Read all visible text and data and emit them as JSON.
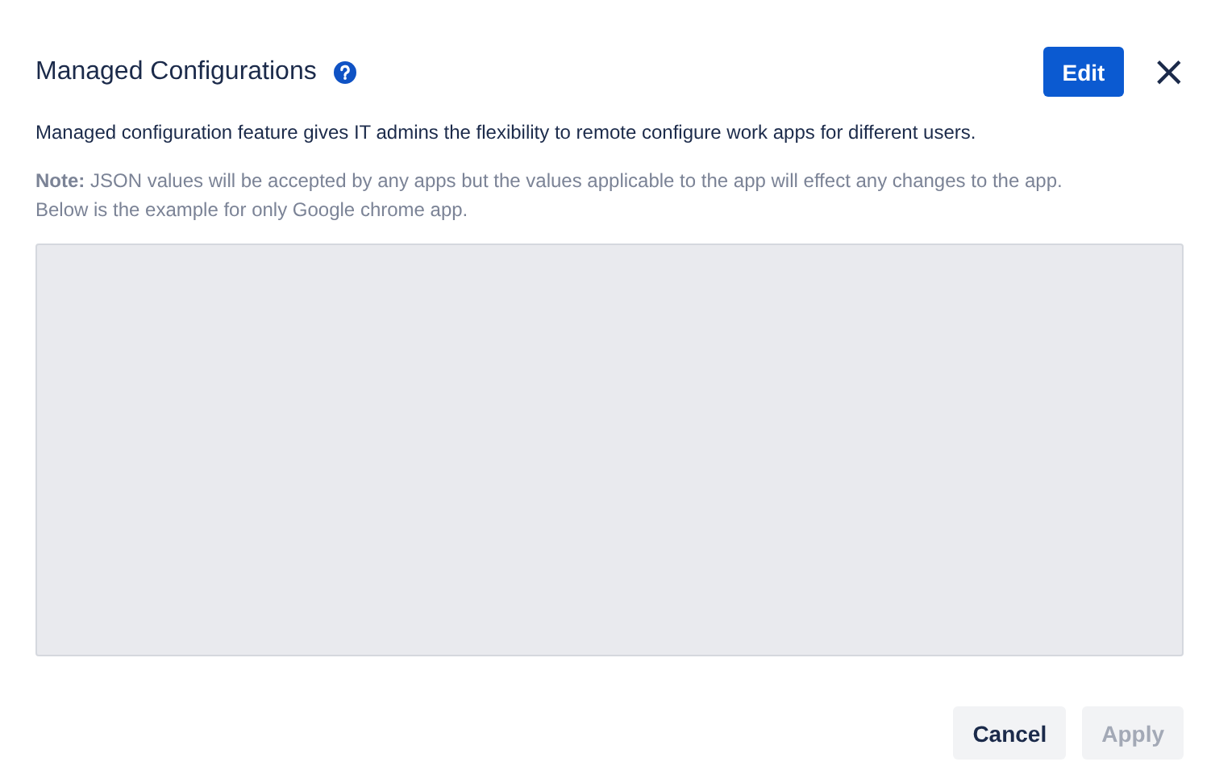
{
  "dialog": {
    "title": "Managed Configurations",
    "description": "Managed configuration feature gives IT admins the flexibility to remote configure work apps for different users.",
    "note": "**Note:** JSON values will be accepted by any apps but the values applicable to the app will effect any changes to the app.\nBelow is the example for only Google chrome app."
  },
  "editor": {
    "disabled": true
  },
  "header_buttons": [
    {
      "label": "Edit",
      "kind": "primary"
    },
    {
      "label": "×",
      "kind": "close"
    }
  ],
  "footer_buttons": [
    {
      "label": "Cancel",
      "disabled": false
    },
    {
      "label": "Apply",
      "disabled": true
    }
  ]
}
